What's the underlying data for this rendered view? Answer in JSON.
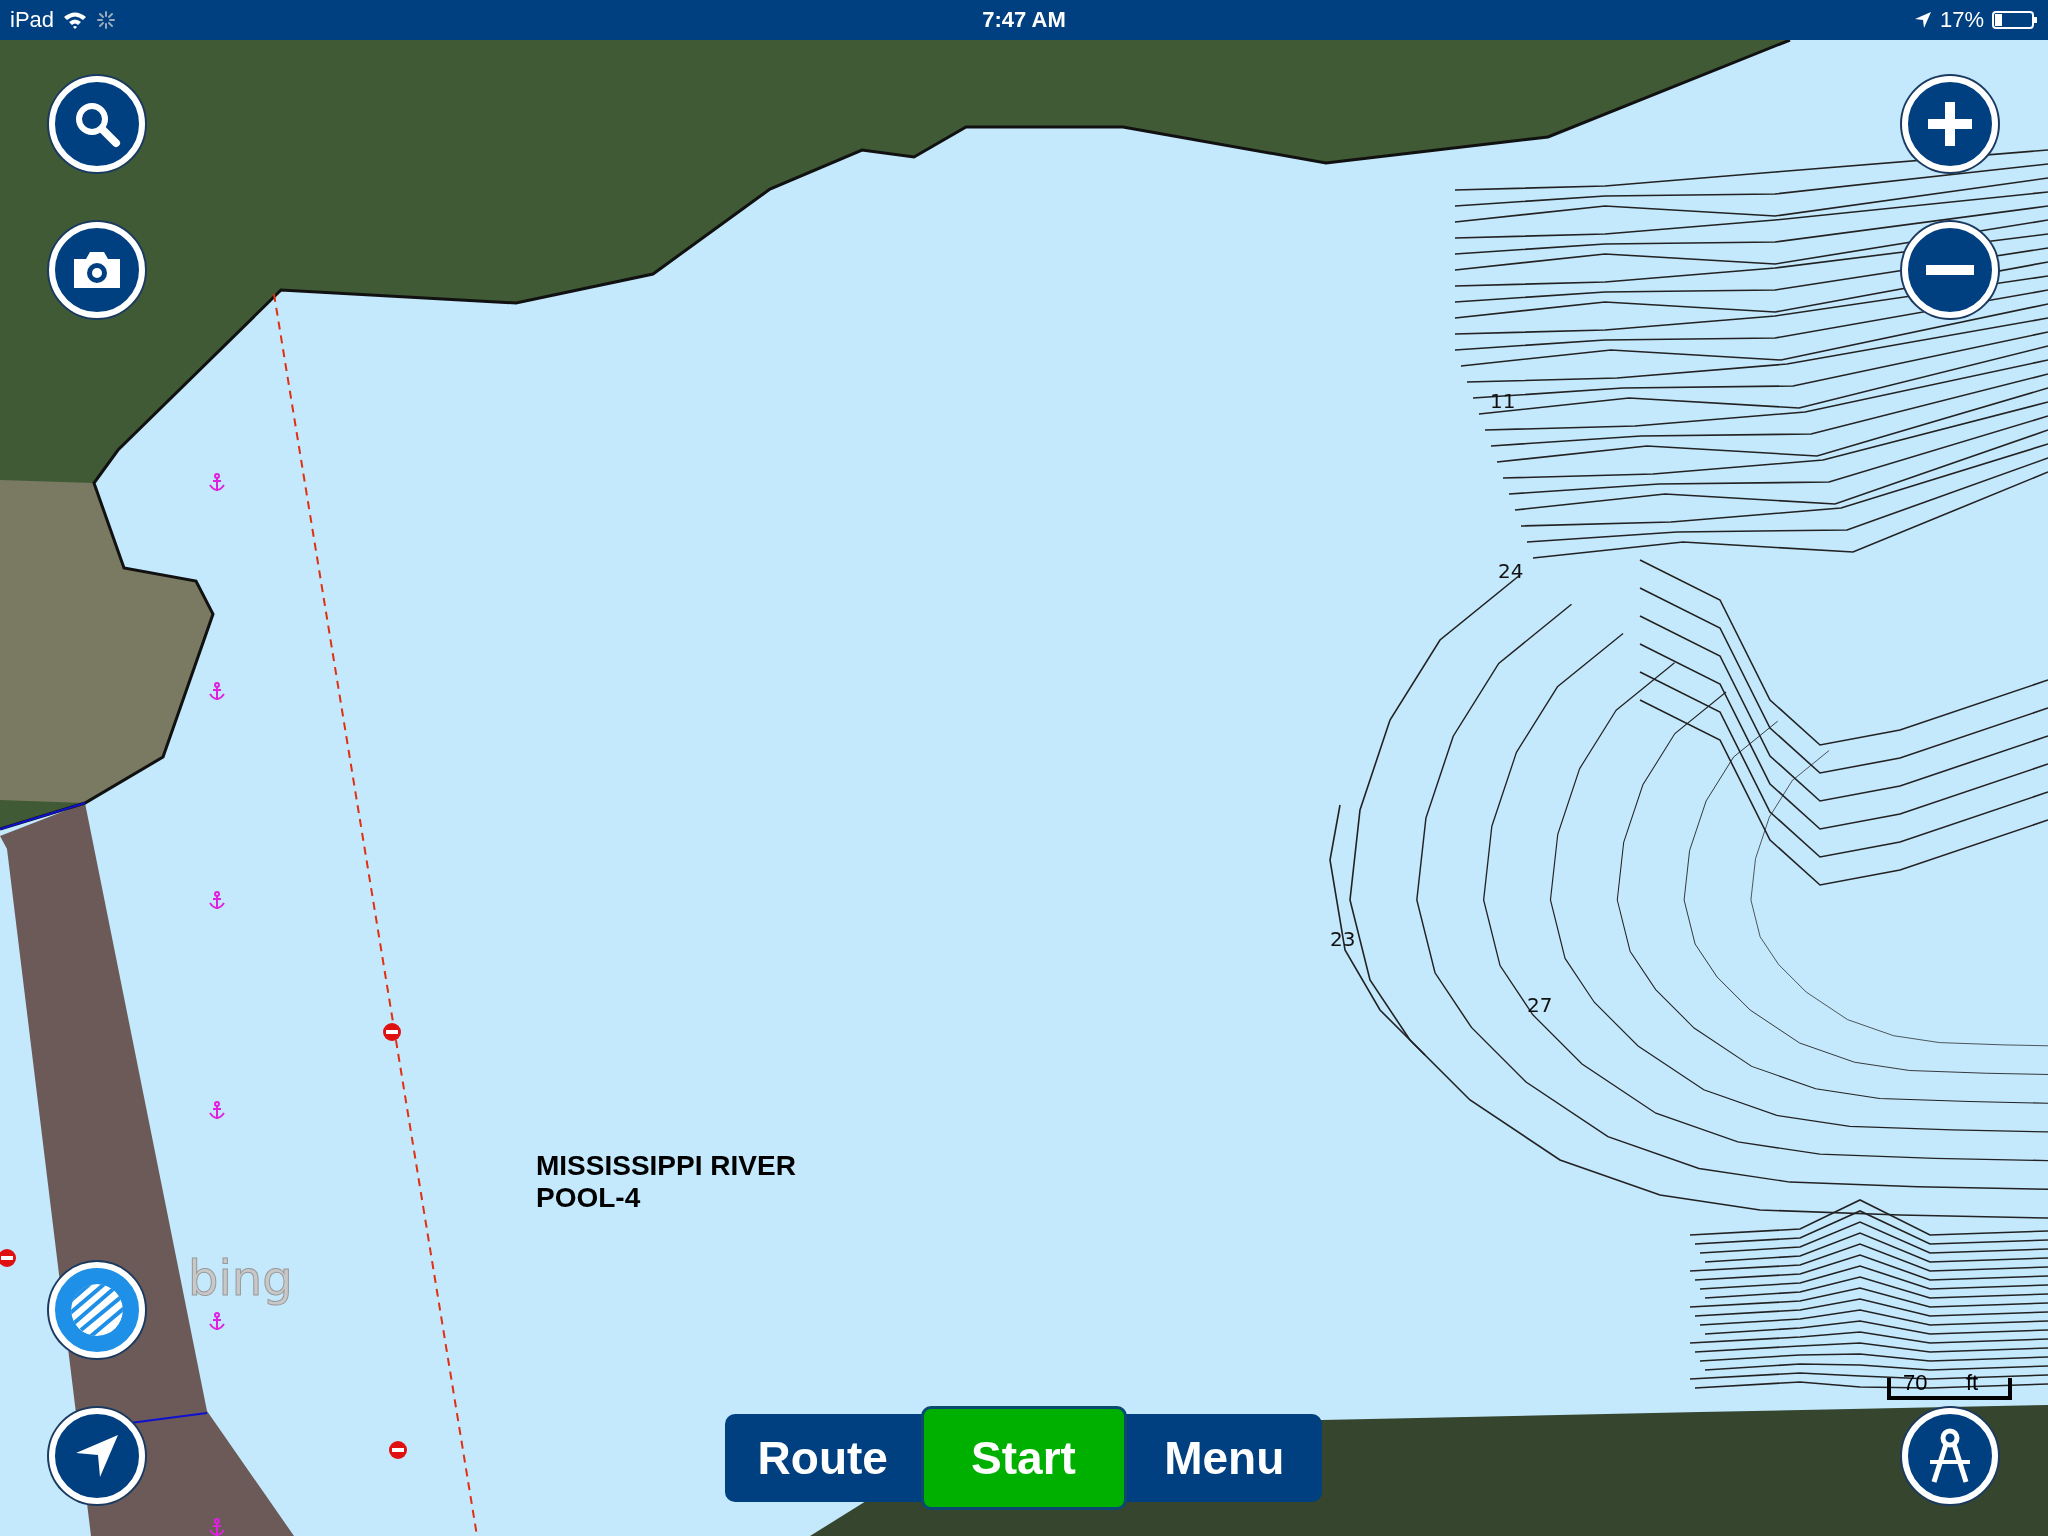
{
  "status_bar": {
    "device": "iPad",
    "time": "7:47 AM",
    "battery": "17%"
  },
  "map": {
    "area_label": [
      "MISSISSIPPI RIVER",
      "POOL-4"
    ],
    "depth_labels": [
      "11",
      "24",
      "23",
      "27"
    ],
    "scale": {
      "value": "70",
      "unit": "ft"
    },
    "attribution": "bing"
  },
  "bottom_bar": [
    {
      "label": "Route",
      "highlighted": false
    },
    {
      "label": "Start",
      "highlighted": true
    },
    {
      "label": "Menu",
      "highlighted": false
    }
  ]
}
